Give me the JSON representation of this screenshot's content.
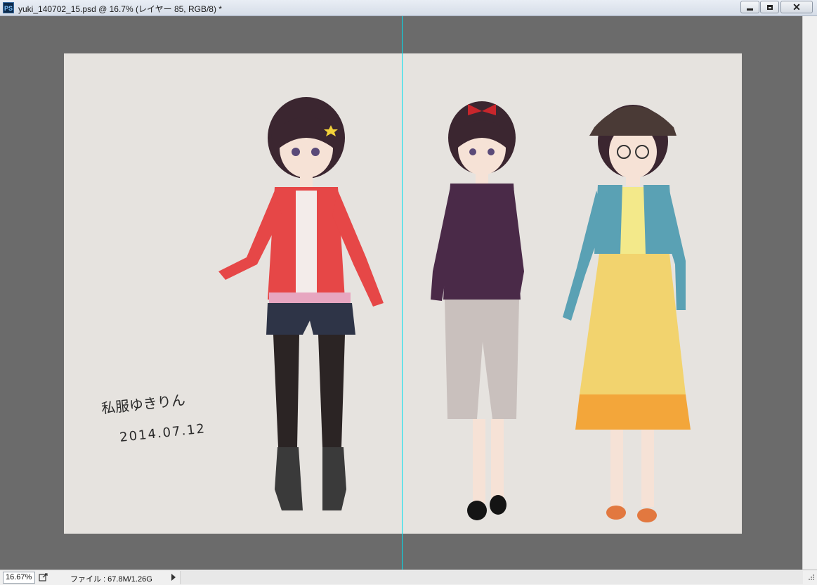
{
  "window": {
    "app_icon": "PS",
    "title": "yuki_140702_15.psd @ 16.7% (レイヤー 85, RGB/8) *"
  },
  "controls": {
    "minimize": "minimize-icon",
    "maximize": "maximize-icon",
    "close": "close-icon",
    "close_glyph": "✕"
  },
  "status": {
    "zoom": "16.67%",
    "doc_info": "ファイル : 67.8M/1.26G"
  },
  "artwork": {
    "signature_line1": "私服ゆきりん",
    "signature_line2": "2014.07.12"
  },
  "colors": {
    "artboard": "#e6e3df",
    "pasteboard": "#6b6b6b",
    "guide": "#00e0f0"
  }
}
